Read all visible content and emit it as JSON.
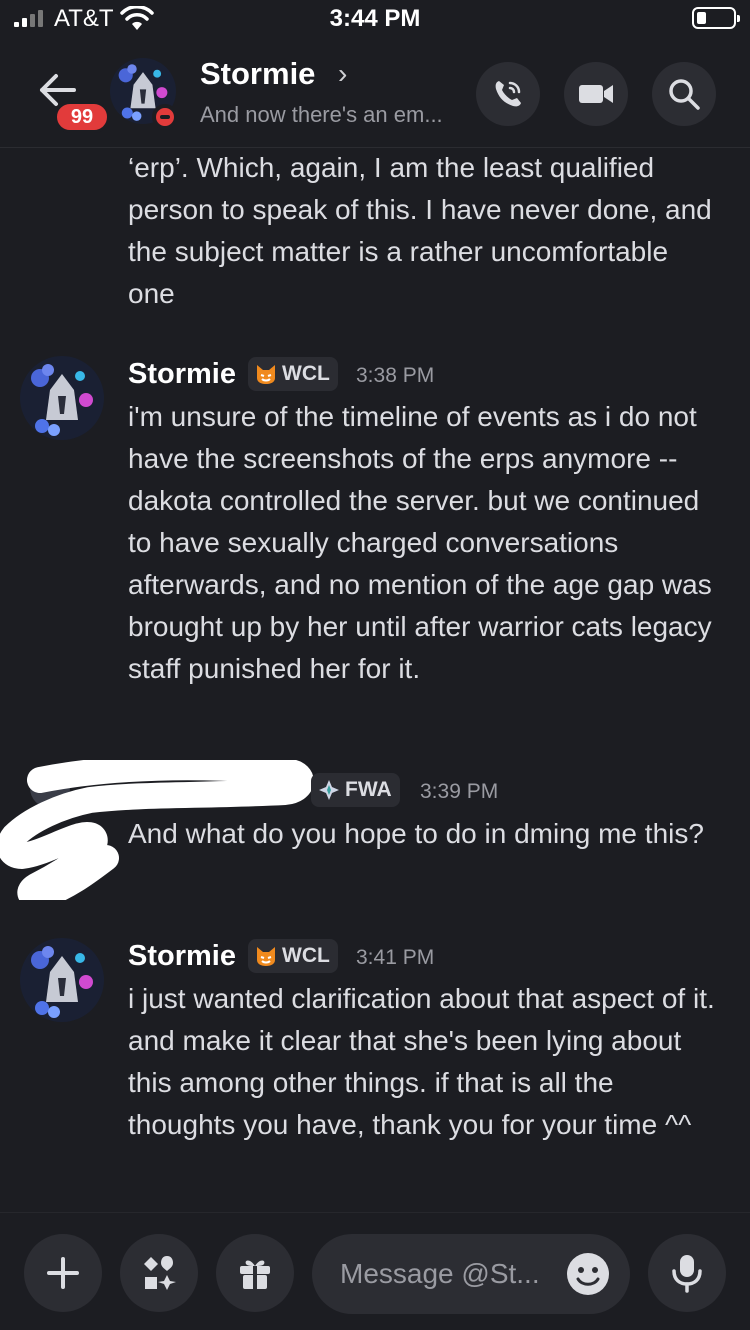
{
  "status_bar": {
    "carrier": "AT&T",
    "time": "3:44 PM"
  },
  "header": {
    "unread_count": "99",
    "name": "Stormie",
    "chevron": "›",
    "status": "And now there's an em..."
  },
  "messages": [
    {
      "continuation_text": "‘erp’. Which, again, I am the least qualified person to speak of this. I have never done, and the subject matter is a rather uncomfortable one"
    },
    {
      "author": "Stormie",
      "tag": "WCL",
      "tag_icon": "cat-face-icon",
      "time": "3:38 PM",
      "text": "i'm unsure of the timeline of events as i do not have the screenshots of the erps anymore -- dakota controlled the server. but we continued to have sexually charged conversations afterwards, and no mention of the age gap was brought up by her until after warrior cats legacy staff punished her for it."
    },
    {
      "author": "",
      "tag": "FWA",
      "tag_icon": "diamond-sparkle-icon",
      "time": "3:39 PM",
      "text": "And what do you hope to do in dming me this?"
    },
    {
      "author": "Stormie",
      "tag": "WCL",
      "tag_icon": "cat-face-icon",
      "time": "3:41 PM",
      "text": "i just wanted clarification about that aspect of it. and make it clear that she's been lying about this among other things. if that is all the thoughts you have, thank you for your time ^^"
    }
  ],
  "composer": {
    "placeholder": "Message @St..."
  },
  "colors": {
    "background": "#1c1d22",
    "badge": "#e23b3b",
    "button": "#2c2d33",
    "muted": "#9a9ba2"
  }
}
